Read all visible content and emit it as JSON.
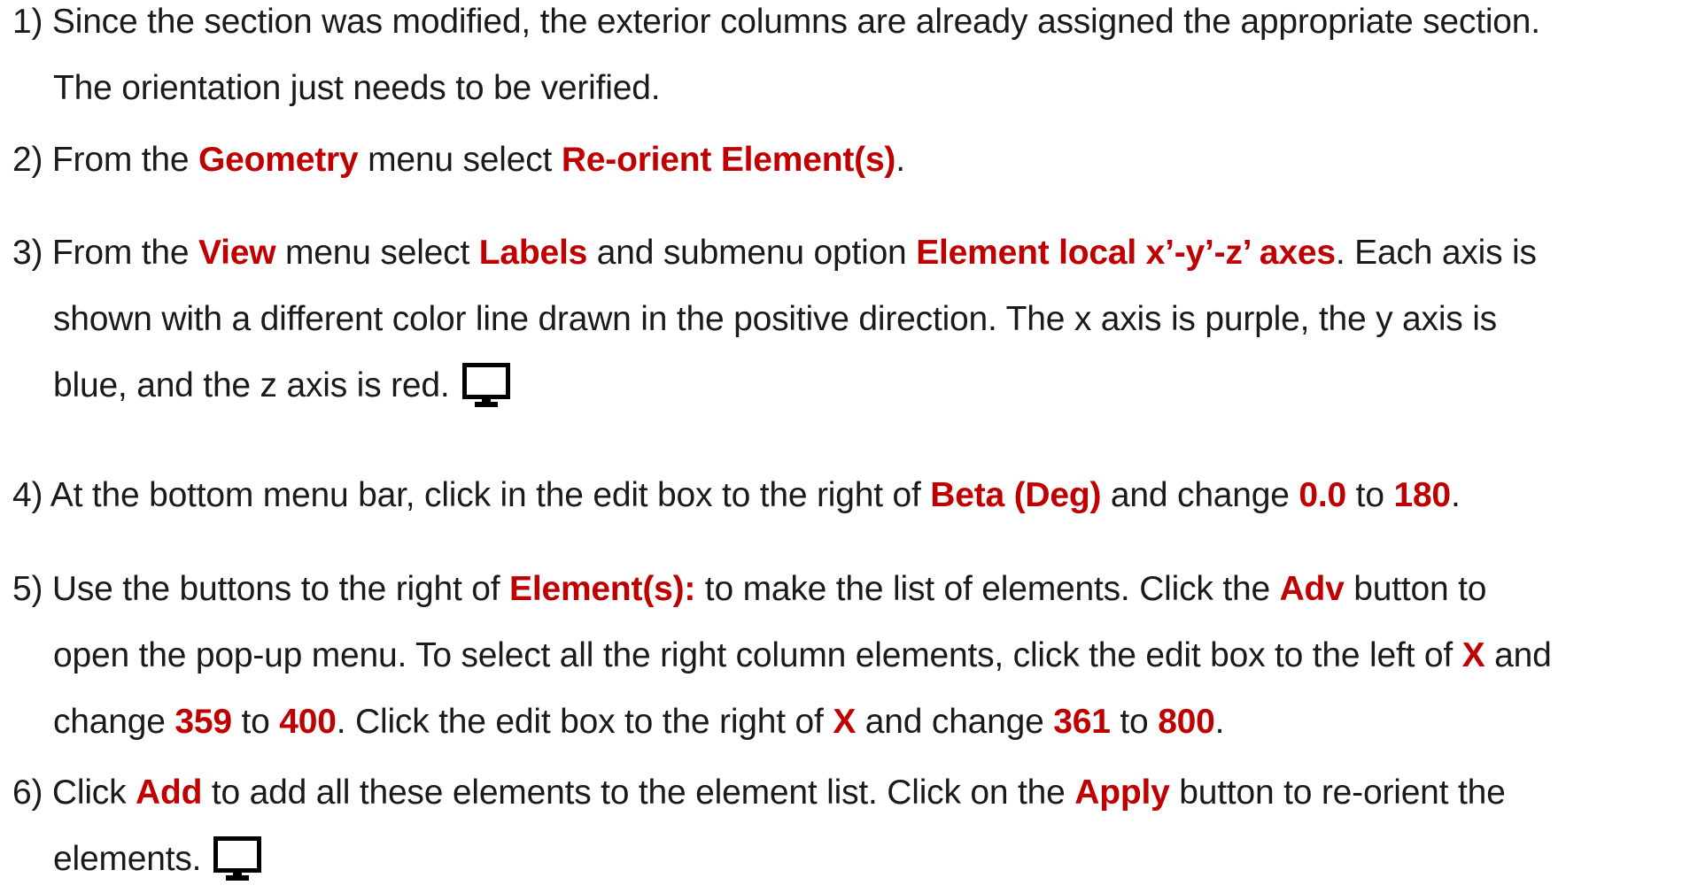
{
  "steps": [
    {
      "lines": [
        [
          {
            "t": "1) Since the section was modified, the exterior columns are already assigned the appropriate section."
          }
        ],
        [
          {
            "t": "The orientation just needs to be verified."
          }
        ]
      ]
    },
    {
      "lines": [
        [
          {
            "t": "2) From the "
          },
          {
            "t": "Geometry",
            "hl": true
          },
          {
            "t": " menu select "
          },
          {
            "t": "Re-orient Element(s)",
            "hl": true
          },
          {
            "t": "."
          }
        ]
      ]
    },
    {
      "lines": [
        [
          {
            "t": "3) From the "
          },
          {
            "t": "View",
            "hl": true
          },
          {
            "t": " menu select "
          },
          {
            "t": "Labels",
            "hl": true
          },
          {
            "t": " and submenu option "
          },
          {
            "t": "Element local x’-y’-z’ axes",
            "hl": true
          },
          {
            "t": ". Each axis is"
          }
        ],
        [
          {
            "t": "shown with a different color line drawn in the positive direction. The x axis is purple, the y axis is"
          }
        ],
        [
          {
            "t": "blue, and the z axis is red."
          },
          {
            "icon": "monitor-icon"
          }
        ]
      ]
    },
    {
      "lines": [
        [
          {
            "t": "4) At the bottom menu bar, click in the edit box to the right of "
          },
          {
            "t": "Beta (Deg)",
            "hl": true
          },
          {
            "t": " and change "
          },
          {
            "t": "0.0",
            "hl": true
          },
          {
            "t": " to "
          },
          {
            "t": "180",
            "hl": true
          },
          {
            "t": "."
          }
        ]
      ]
    },
    {
      "lines": [
        [
          {
            "t": "5) Use the buttons to the right of "
          },
          {
            "t": "Element(s):",
            "hl": true
          },
          {
            "t": " to make the list of elements. Click the "
          },
          {
            "t": "Adv",
            "hl": true
          },
          {
            "t": " button to"
          }
        ],
        [
          {
            "t": "open the pop-up menu. To select all the right column elements, click the edit box to the left of "
          },
          {
            "t": "X",
            "hl": true
          },
          {
            "t": " and"
          }
        ],
        [
          {
            "t": "change "
          },
          {
            "t": "359",
            "hl": true
          },
          {
            "t": " to "
          },
          {
            "t": "400",
            "hl": true
          },
          {
            "t": ". Click the edit box to the right of "
          },
          {
            "t": "X",
            "hl": true
          },
          {
            "t": " and change "
          },
          {
            "t": "361",
            "hl": true
          },
          {
            "t": " to "
          },
          {
            "t": "800",
            "hl": true
          },
          {
            "t": "."
          }
        ]
      ]
    },
    {
      "lines": [
        [
          {
            "t": "6) Click "
          },
          {
            "t": "Add",
            "hl": true
          },
          {
            "t": " to add all these elements to the element list. Click on the "
          },
          {
            "t": "Apply",
            "hl": true
          },
          {
            "t": " button to re-orient the"
          }
        ],
        [
          {
            "t": "elements."
          },
          {
            "icon": "monitor-icon"
          }
        ]
      ]
    }
  ]
}
